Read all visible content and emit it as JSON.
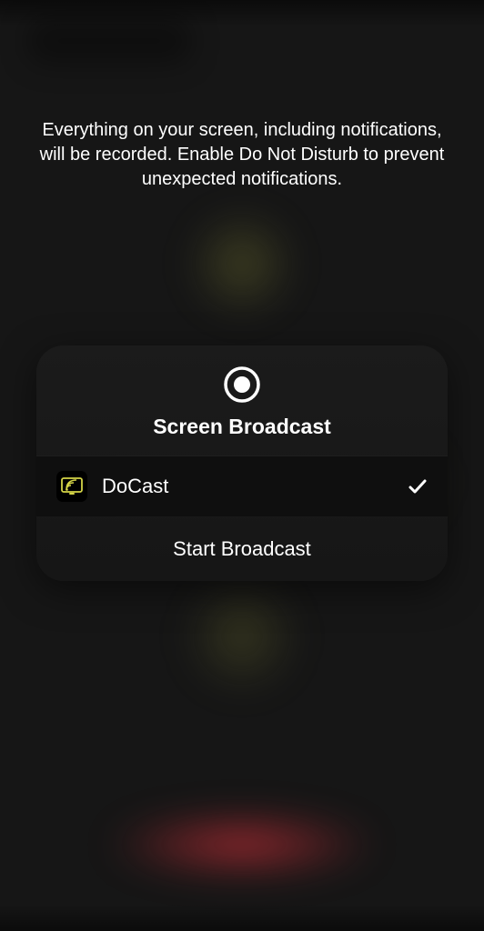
{
  "info_text": "Everything on your screen, including notifications, will be recorded. Enable Do Not Disturb to prevent unexpected notifications.",
  "sheet": {
    "title": "Screen Broadcast",
    "option": {
      "name": "DoCast",
      "selected": true
    },
    "action": "Start Broadcast"
  }
}
